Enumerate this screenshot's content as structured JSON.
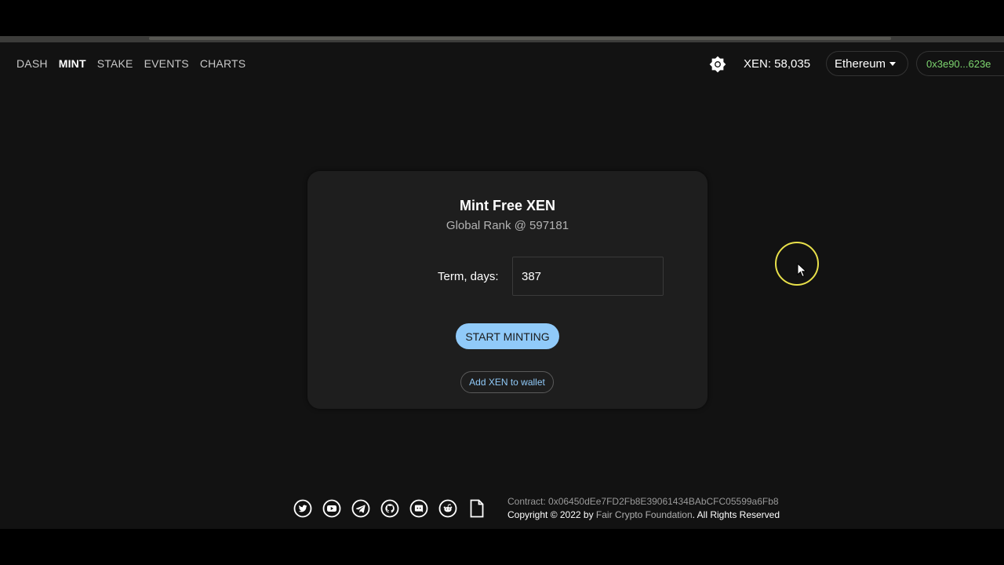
{
  "nav": {
    "links": [
      {
        "label": "DASH",
        "active": false
      },
      {
        "label": "MINT",
        "active": true
      },
      {
        "label": "STAKE",
        "active": false
      },
      {
        "label": "EVENTS",
        "active": false
      },
      {
        "label": "CHARTS",
        "active": false
      }
    ],
    "theme_icon": "sun-icon",
    "xen_balance": "XEN: 58,035",
    "network": "Ethereum",
    "wallet_address": "0x3e90...623e"
  },
  "mint_card": {
    "title": "Mint Free XEN",
    "subtitle": "Global Rank @ 597181",
    "term_label": "Term, days:",
    "term_value": "387",
    "start_button": "START MINTING",
    "add_wallet_button": "Add XEN to wallet"
  },
  "footer": {
    "icons": [
      "twitter-icon",
      "youtube-icon",
      "telegram-icon",
      "github-icon",
      "discord-icon",
      "reddit-icon",
      "document-icon"
    ],
    "contract": "Contract: 0x06450dEe7FD2Fb8E39061434BAbCFC05599a6Fb8",
    "copyright_prefix": "Copyright © 2022 by ",
    "foundation": "Fair Crypto Foundation",
    "copyright_suffix": ". All Rights Reserved"
  },
  "colors": {
    "background": "#121212",
    "card": "#1e1e1e",
    "accent_blue": "#90caf9",
    "address_green": "#7dd56f",
    "cursor_highlight": "#e8e04a"
  }
}
